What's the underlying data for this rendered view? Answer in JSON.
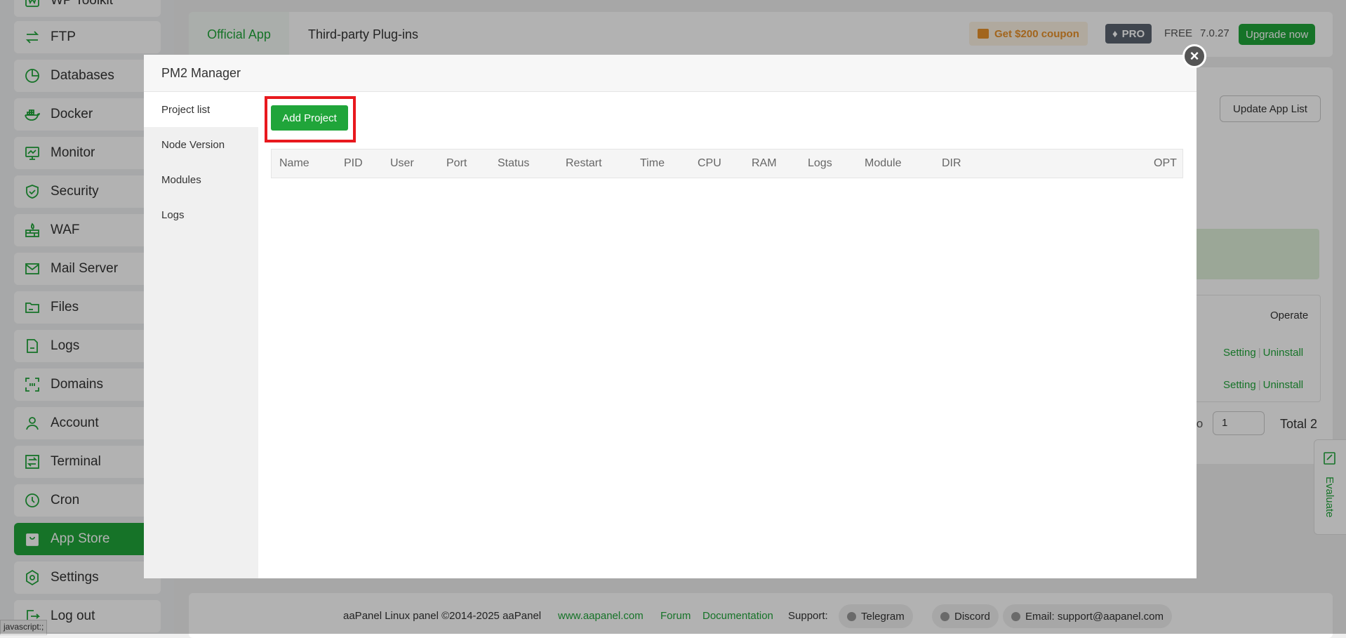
{
  "sidebar": {
    "items": [
      {
        "label": "WP Toolkit",
        "icon": "wordpress-icon"
      },
      {
        "label": "FTP",
        "icon": "transfer-arrows-icon"
      },
      {
        "label": "Databases",
        "icon": "pie-chart-icon"
      },
      {
        "label": "Docker",
        "icon": "docker-whale-icon"
      },
      {
        "label": "Monitor",
        "icon": "monitor-chart-icon"
      },
      {
        "label": "Security",
        "icon": "shield-icon"
      },
      {
        "label": "WAF",
        "icon": "firewall-icon"
      },
      {
        "label": "Mail Server",
        "icon": "mail-icon"
      },
      {
        "label": "Files",
        "icon": "folder-icon"
      },
      {
        "label": "Logs",
        "icon": "log-file-icon"
      },
      {
        "label": "Domains",
        "icon": "domain-scan-icon"
      },
      {
        "label": "Account",
        "icon": "user-icon"
      },
      {
        "label": "Terminal",
        "icon": "terminal-icon"
      },
      {
        "label": "Cron",
        "icon": "clock-icon"
      },
      {
        "label": "App Store",
        "icon": "store-bag-icon",
        "active": true
      },
      {
        "label": "Settings",
        "icon": "gear-icon"
      },
      {
        "label": "Log out",
        "icon": "logout-icon"
      }
    ]
  },
  "topbar": {
    "tab_official": "Official App",
    "tab_third_party": "Third-party Plug-ins",
    "coupon": "Get $200 coupon",
    "pro": "PRO",
    "free": "FREE",
    "version": "7.0.27",
    "upgrade": "Upgrade now"
  },
  "background": {
    "update_app_list": "Update App List",
    "operate_header": "Operate",
    "row_links": [
      {
        "setting": "Setting",
        "uninstall": "Uninstall"
      },
      {
        "setting": "Setting",
        "uninstall": "Uninstall"
      }
    ],
    "pager_to": "to",
    "pager_value": "1",
    "pager_total": "Total 2",
    "evaluate": "Evaluate"
  },
  "footer": {
    "copyright": "aaPanel Linux panel ©2014-2025 aaPanel",
    "site_link": "www.aapanel.com",
    "forum": "Forum",
    "documentation": "Documentation",
    "support_label": "Support:",
    "telegram": "Telegram",
    "discord": "Discord",
    "email": "Email: support@aapanel.com"
  },
  "status_tip": "javascript:;",
  "modal": {
    "title": "PM2 Manager",
    "close_icon": "close-icon",
    "nav": [
      "Project list",
      "Node Version",
      "Modules",
      "Logs"
    ],
    "active_nav": "Project list",
    "add_project": "Add Project",
    "table_headers": [
      "Name",
      "PID",
      "User",
      "Port",
      "Status",
      "Restart",
      "Time",
      "CPU",
      "RAM",
      "Logs",
      "Module",
      "DIR",
      "OPT"
    ],
    "rows": []
  },
  "colors": {
    "accent": "#20a53a",
    "highlight_box": "#e8191e",
    "coupon_text": "#e8912a",
    "pro_badge": "#5b6470"
  }
}
